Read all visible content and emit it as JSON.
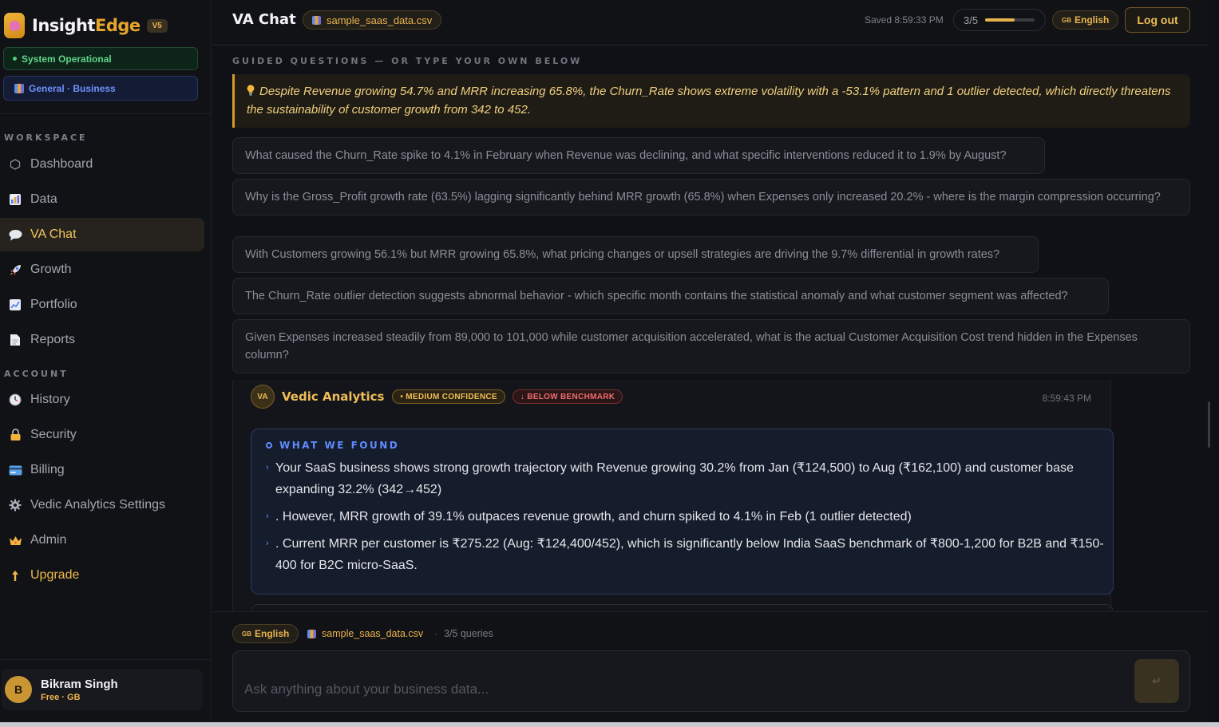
{
  "brand": {
    "name_main": "Insight",
    "name_accent": "Edge",
    "version": "V5"
  },
  "system_status": "System Operational",
  "workspace_pill": "General · Business",
  "sidebar": {
    "workspace_label": "WORKSPACE",
    "workspace_items": [
      {
        "label": "Dashboard",
        "icon": "hexagon-icon"
      },
      {
        "label": "Data",
        "icon": "bar-chart-icon"
      },
      {
        "label": "VA Chat",
        "icon": "speech-bubble-icon",
        "active": true
      },
      {
        "label": "Growth",
        "icon": "rocket-icon"
      },
      {
        "label": "Portfolio",
        "icon": "line-chart-icon"
      },
      {
        "label": "Reports",
        "icon": "document-icon"
      }
    ],
    "account_label": "ACCOUNT",
    "account_items": [
      {
        "label": "History",
        "icon": "clock-icon"
      },
      {
        "label": "Security",
        "icon": "lock-icon"
      },
      {
        "label": "Billing",
        "icon": "credit-card-icon"
      },
      {
        "label": "Vedic Analytics Settings",
        "icon": "gear-icon"
      },
      {
        "label": "Admin",
        "icon": "crown-icon"
      },
      {
        "label": "Upgrade",
        "icon": "arrow-up-icon"
      }
    ]
  },
  "user": {
    "initial": "B",
    "name": "Bikram Singh",
    "plan": "Free · GB"
  },
  "header": {
    "title": "VA Chat",
    "file": "sample_saas_data.csv",
    "saved": "Saved 8:59:33 PM",
    "quota_text": "3/5",
    "quota_fraction": 0.6,
    "language": "English",
    "lang_flag": "GB",
    "logout": "Log out"
  },
  "guided": {
    "label": "GUIDED QUESTIONS — OR TYPE YOUR OWN BELOW",
    "insight": "Despite Revenue growing 54.7% and MRR increasing 65.8%, the Churn_Rate shows extreme volatility with a -53.1% pattern and 1 outlier detected, which directly threatens the sustainability of customer growth from 342 to 452.",
    "questions": [
      "What caused the Churn_Rate spike to 4.1% in February when Revenue was declining, and what specific interventions reduced it to 1.9% by August?",
      "Why is the Gross_Profit growth rate (63.5%) lagging significantly behind MRR growth (65.8%) when Expenses only increased 20.2% - where is the margin compression occurring?",
      "With Customers growing 56.1% but MRR growing 65.8%, what pricing changes or upsell strategies are driving the 9.7% differential in growth rates?",
      "The Churn_Rate outlier detection suggests abnormal behavior - which specific month contains the statistical anomaly and what customer segment was affected?",
      "Given Expenses increased steadily from 89,000 to 101,000 while customer acquisition accelerated, what is the actual Customer Acquisition Cost trend hidden in the Expenses column?"
    ]
  },
  "message": {
    "badge": "VA",
    "sender": "Vedic Analytics",
    "confidence": "• MEDIUM CONFIDENCE",
    "benchmark": "↓ BELOW BENCHMARK",
    "time": "8:59:43 PM",
    "found_title": "WHAT WE FOUND",
    "findings": [
      "Your SaaS business shows strong growth trajectory with Revenue growing 30.2% from Jan (₹124,500) to Aug (₹162,100) and customer base expanding 32.2% (342→452)",
      ". However, MRR growth of 39.1% outpaces revenue growth, and churn spiked to 4.1% in Feb (1 outlier detected)",
      ". Current MRR per customer is ₹275.22 (Aug: ₹124,400/452), which is significantly below India SaaS benchmark of ₹800-1,200 for B2B and ₹150-400 for B2C micro-SaaS."
    ]
  },
  "composer": {
    "language": "English",
    "lang_flag": "GB",
    "file": "sample_saas_data.csv",
    "separator": "·",
    "queries": "3/5 queries",
    "placeholder": "Ask anything about your business data...",
    "send_icon": "↵"
  }
}
